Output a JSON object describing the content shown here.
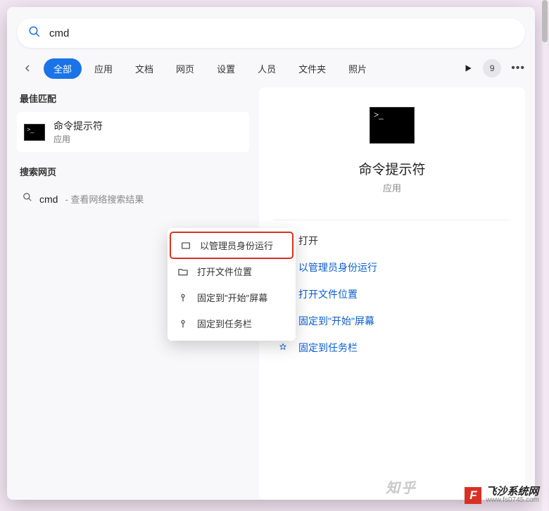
{
  "search": {
    "query": "cmd"
  },
  "filters": {
    "items": [
      "全部",
      "应用",
      "文档",
      "网页",
      "设置",
      "人员",
      "文件夹",
      "照片"
    ],
    "badge": "9"
  },
  "left": {
    "bestMatchLabel": "最佳匹配",
    "result": {
      "title": "命令提示符",
      "subtitle": "应用"
    },
    "webLabel": "搜索网页",
    "webQuery": "cmd",
    "webSuffix": " - 查看网络搜索结果"
  },
  "context": {
    "items": [
      {
        "label": "以管理员身份运行",
        "icon": "admin"
      },
      {
        "label": "打开文件位置",
        "icon": "folder"
      },
      {
        "label": "固定到\"开始\"屏幕",
        "icon": "pin"
      },
      {
        "label": "固定到任务栏",
        "icon": "pin"
      }
    ]
  },
  "preview": {
    "title": "命令提示符",
    "subtitle": "应用",
    "actions": [
      {
        "label": "打开",
        "icon": "open",
        "blue": false
      },
      {
        "label": "以管理员身份运行",
        "icon": "admin",
        "blue": true
      },
      {
        "label": "打开文件位置",
        "icon": "folder",
        "blue": true
      },
      {
        "label": "固定到\"开始\"屏幕",
        "icon": "pin",
        "blue": true
      },
      {
        "label": "固定到任务栏",
        "icon": "pin",
        "blue": true
      }
    ]
  },
  "watermarks": {
    "zhihu": "知乎",
    "siteBadge": "F",
    "siteName": "飞沙系统网",
    "siteUrl": "www.fs0745.com"
  }
}
